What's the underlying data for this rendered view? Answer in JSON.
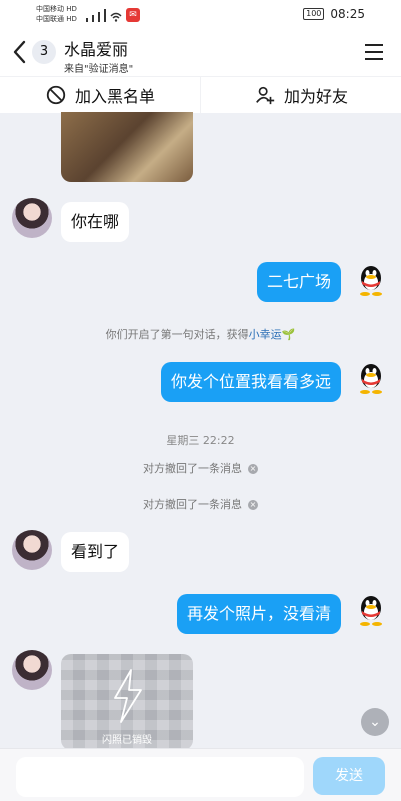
{
  "status": {
    "carrier1": "中国移动",
    "carrier2": "中国联通",
    "hd": "HD",
    "battery": "100",
    "time": "08:25"
  },
  "header": {
    "back_count": "3",
    "title": "水晶爱丽",
    "subtitle": "来自\"验证消息\""
  },
  "actions": {
    "blacklist": "加入黑名单",
    "add_friend": "加为好友"
  },
  "messages": [
    {
      "side": "left",
      "text": "你在哪"
    },
    {
      "side": "right",
      "text": "二七广场"
    },
    {
      "side": "system",
      "text": "你们开启了第一句对话，获得",
      "link": "小幸运"
    },
    {
      "side": "right",
      "text": "你发个位置我看看多远"
    },
    {
      "side": "time",
      "text": "星期三 22:22"
    },
    {
      "side": "system",
      "text": "对方撤回了一条消息"
    },
    {
      "side": "system",
      "text": "对方撤回了一条消息"
    },
    {
      "side": "left",
      "text": "看到了"
    },
    {
      "side": "right",
      "text": "再发个照片，没看清"
    },
    {
      "side": "flash",
      "text": "闪照已销毁"
    }
  ],
  "input": {
    "placeholder": "",
    "send_label": "发送"
  }
}
